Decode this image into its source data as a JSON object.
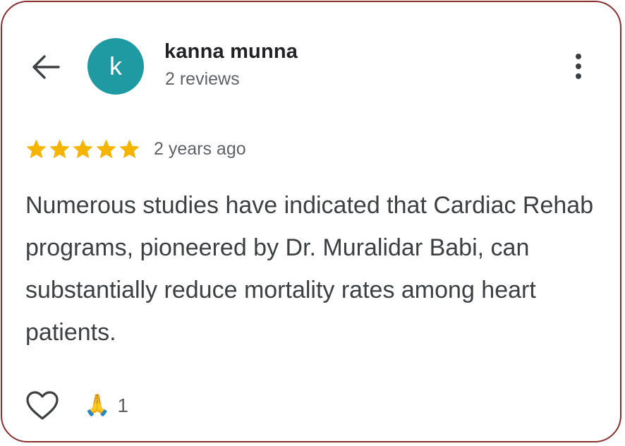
{
  "reviewer": {
    "avatar_letter": "k",
    "avatar_color": "#1f9aa3",
    "name": "kanna munna",
    "review_count": "2 reviews"
  },
  "review": {
    "rating": 5,
    "max_rating": 5,
    "star_color": "#f4b400",
    "time_ago": "2 years ago",
    "text": "Numerous studies have indicated that Cardiac Rehab programs, pioneered by Dr. Muralidar Babi, can substantially reduce mortality rates among heart patients."
  },
  "actions": {
    "like_icon": "heart-outline-icon",
    "reaction_emoji": "🙏",
    "reaction_count": "1"
  },
  "icons": {
    "back": "arrow-left-icon",
    "more": "more-vertical-icon"
  }
}
